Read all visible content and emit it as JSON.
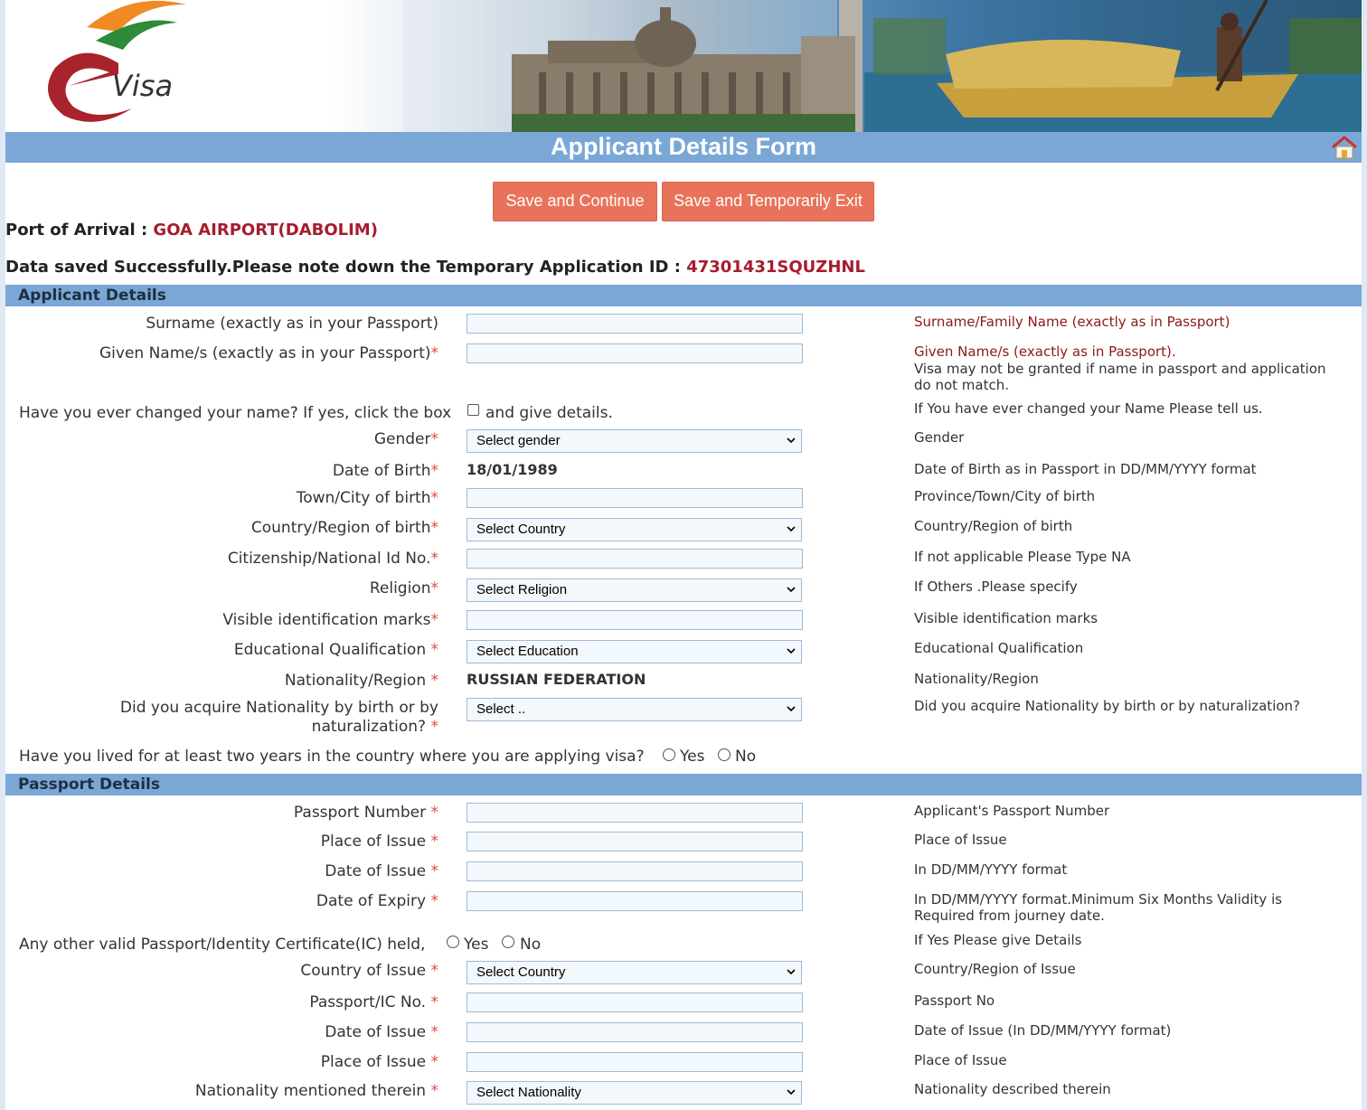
{
  "banner": {
    "logo_text": "Visa"
  },
  "header": {
    "title": "Applicant Details Form"
  },
  "actions": {
    "save_continue": "Save and Continue",
    "save_exit": "Save and Temporarily Exit"
  },
  "arrival": {
    "label": "Port of Arrival :",
    "value": "GOA AIRPORT(DABOLIM)"
  },
  "saved": {
    "message": "Data saved Successfully.Please note down the Temporary Application ID :",
    "app_id": "47301431SQUZHNL"
  },
  "applicant": {
    "section_title": "Applicant Details",
    "surname_label": "Surname (exactly as in your Passport)",
    "surname_hint": "Surname/Family Name (exactly as in Passport)",
    "given_label": "Given Name/s (exactly as in your Passport)",
    "given_hint": "Given Name/s (exactly as in Passport).",
    "given_warning": "Visa may not be granted if name in passport and application do not match.",
    "changed_label": "Have you ever changed your name? If yes, click the box",
    "changed_suffix": "and give details.",
    "changed_hint": "If You have ever changed your Name Please tell us.",
    "gender_label": "Gender",
    "gender_value": "Select gender",
    "gender_hint": "Gender",
    "dob_label": "Date of Birth",
    "dob_value": "18/01/1989",
    "dob_hint": "Date of Birth as in Passport in DD/MM/YYYY format",
    "town_label": "Town/City of birth",
    "town_hint": "Province/Town/City of birth",
    "country_birth_label": "Country/Region of birth",
    "country_birth_value": "Select Country",
    "country_birth_hint": "Country/Region of birth",
    "citizenship_label": "Citizenship/National Id No.",
    "citizenship_hint": "If not applicable Please Type NA",
    "religion_label": "Religion",
    "religion_value": "Select Religion",
    "religion_hint": "If Others .Please specify",
    "marks_label": "Visible identification marks",
    "marks_hint": "Visible identification marks",
    "education_label": "Educational Qualification",
    "education_value": "Select Education",
    "education_hint": "Educational Qualification",
    "nationality_label": "Nationality/Region",
    "nationality_value": "RUSSIAN FEDERATION",
    "nationality_hint": "Nationality/Region",
    "acquire_label": "Did you acquire Nationality by birth or by naturalization?",
    "acquire_value": "Select ..",
    "acquire_hint": "Did you acquire Nationality by birth or by naturalization?",
    "lived_label": "Have you lived for at least two years in the country where you are applying visa?",
    "yes": "Yes",
    "no": "No"
  },
  "passport": {
    "section_title": "Passport Details",
    "number_label": "Passport Number",
    "number_hint": "Applicant's Passport Number",
    "place_label": "Place of Issue",
    "place_hint": "Place of Issue",
    "date_issue_label": "Date of Issue",
    "date_issue_hint": "In DD/MM/YYYY format",
    "expiry_label": "Date of Expiry",
    "expiry_hint": "In DD/MM/YYYY format.Minimum Six Months Validity is Required from journey date.",
    "other_label": "Any other valid Passport/Identity Certificate(IC) held,",
    "other_hint": "If Yes Please give Details",
    "yes": "Yes",
    "no": "No",
    "country_issue_label": "Country of Issue",
    "country_issue_value": "Select Country",
    "country_issue_hint": "Country/Region of Issue",
    "ic_no_label": "Passport/IC No.",
    "ic_no_hint": "Passport No",
    "ic_date_label": "Date of Issue",
    "ic_date_hint": "Date of Issue (In DD/MM/YYYY format)",
    "ic_place_label": "Place of Issue",
    "ic_place_hint": "Place of Issue",
    "ic_nat_label": "Nationality mentioned therein",
    "ic_nat_value": "Select Nationality",
    "ic_nat_hint": "Nationality described therein"
  },
  "required_mark": "*",
  "colors": {
    "accent": "#7aa7d6",
    "button": "#e8735a",
    "required": "#e04848",
    "highlight": "#a51d2d"
  },
  "icons": [
    "e-visa-logo",
    "home-icon",
    "chevron-down-icon"
  ]
}
